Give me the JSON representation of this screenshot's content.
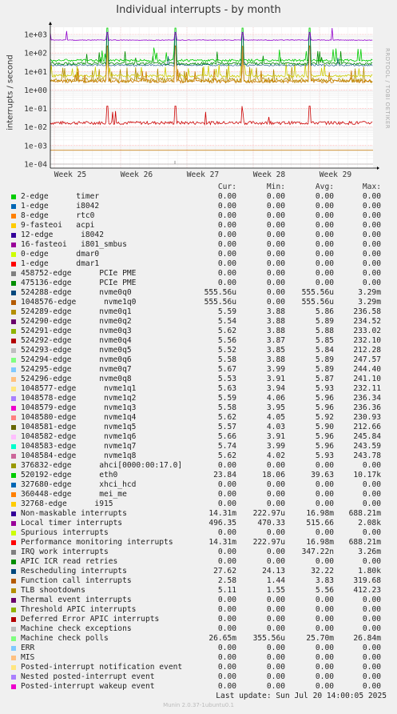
{
  "chart_data": {
    "type": "line",
    "title": "Individual interrupts - by month",
    "ylabel": "interrupts / second",
    "yscale": "log",
    "ylim": [
      0.0001,
      1000
    ],
    "yticks": [
      "1e+03",
      "1e+02",
      "1e+01",
      "1e+00",
      "1e-01",
      "1e-02",
      "1e-03",
      "1e-04"
    ],
    "xticks": [
      "Week 25",
      "Week 26",
      "Week 27",
      "Week 28",
      "Week 29"
    ],
    "grid": true,
    "series_approx": [
      {
        "name": "Local timer interrupts",
        "color": "#8f00cc",
        "level": 496
      },
      {
        "name": "Rescheduling interrupts",
        "color": "#008f00",
        "level": 27
      },
      {
        "name": "Function call interrupts",
        "color": "#cc7a00",
        "level": 3.8
      },
      {
        "name": "Machine check polls",
        "color": "#8f8f00",
        "level": 26
      },
      {
        "name": "TLB shootdowns",
        "color": "#b38f00",
        "level": 5
      },
      {
        "name": "nvme queues",
        "color": "#cccc00",
        "level": 5.8
      },
      {
        "name": "eth0",
        "color": "#00cc00",
        "level": 40
      },
      {
        "name": "Performance monitoring interrupts",
        "color": "#cc0000",
        "level": 0.017
      },
      {
        "name": "nvme0q0",
        "color": "#cc7a00",
        "level": 0.000556
      },
      {
        "name": "IRQ work interrupts",
        "color": "#b0b0b0",
        "level": 0.0001
      }
    ]
  },
  "watermark": "RRDTOOL / TOBI OETIKER",
  "legend_header": {
    "cur": "Cur:",
    "min": "Min:",
    "avg": "Avg:",
    "max": "Max:"
  },
  "legend": [
    {
      "label": "2-edge      timer",
      "color": "#00cc00",
      "cur": "0.00",
      "min": "0.00",
      "avg": "0.00",
      "max": "0.00"
    },
    {
      "label": "1-edge      i8042",
      "color": "#0066b3",
      "cur": "0.00",
      "min": "0.00",
      "avg": "0.00",
      "max": "0.00"
    },
    {
      "label": "8-edge      rtc0",
      "color": "#ff8000",
      "cur": "0.00",
      "min": "0.00",
      "avg": "0.00",
      "max": "0.00"
    },
    {
      "label": "9-fasteoi   acpi",
      "color": "#ffcc00",
      "cur": "0.00",
      "min": "0.00",
      "avg": "0.00",
      "max": "0.00"
    },
    {
      "label": "12-edge      i8042",
      "color": "#330099",
      "cur": "0.00",
      "min": "0.00",
      "avg": "0.00",
      "max": "0.00"
    },
    {
      "label": "16-fasteoi   i801_smbus",
      "color": "#990099",
      "cur": "0.00",
      "min": "0.00",
      "avg": "0.00",
      "max": "0.00"
    },
    {
      "label": "0-edge      dmar0",
      "color": "#ccff00",
      "cur": "0.00",
      "min": "0.00",
      "avg": "0.00",
      "max": "0.00"
    },
    {
      "label": "1-edge      dmar1",
      "color": "#ff0000",
      "cur": "0.00",
      "min": "0.00",
      "avg": "0.00",
      "max": "0.00"
    },
    {
      "label": "458752-edge      PCIe PME",
      "color": "#808080",
      "cur": "0.00",
      "min": "0.00",
      "avg": "0.00",
      "max": "0.00"
    },
    {
      "label": "475136-edge      PCIe PME",
      "color": "#008f00",
      "cur": "0.00",
      "min": "0.00",
      "avg": "0.00",
      "max": "0.00"
    },
    {
      "label": "524288-edge      nvme0q0",
      "color": "#00487d",
      "cur": "555.56u",
      "min": "0.00",
      "avg": "555.56u",
      "max": "3.29m"
    },
    {
      "label": "1048576-edge      nvme1q0",
      "color": "#b35a00",
      "cur": "555.56u",
      "min": "0.00",
      "avg": "555.56u",
      "max": "3.29m"
    },
    {
      "label": "524289-edge      nvme0q1",
      "color": "#b38f00",
      "cur": "5.59",
      "min": "3.88",
      "avg": "5.86",
      "max": "236.58"
    },
    {
      "label": "524290-edge      nvme0q2",
      "color": "#6b006b",
      "cur": "5.54",
      "min": "3.88",
      "avg": "5.89",
      "max": "234.52"
    },
    {
      "label": "524291-edge      nvme0q3",
      "color": "#8fb300",
      "cur": "5.62",
      "min": "3.88",
      "avg": "5.88",
      "max": "233.02"
    },
    {
      "label": "524292-edge      nvme0q4",
      "color": "#b30000",
      "cur": "5.56",
      "min": "3.87",
      "avg": "5.85",
      "max": "232.10"
    },
    {
      "label": "524293-edge      nvme0q5",
      "color": "#bebebe",
      "cur": "5.52",
      "min": "3.85",
      "avg": "5.84",
      "max": "212.28"
    },
    {
      "label": "524294-edge      nvme0q6",
      "color": "#80ff80",
      "cur": "5.58",
      "min": "3.88",
      "avg": "5.89",
      "max": "247.57"
    },
    {
      "label": "524295-edge      nvme0q7",
      "color": "#80c9ff",
      "cur": "5.67",
      "min": "3.99",
      "avg": "5.89",
      "max": "244.40"
    },
    {
      "label": "524296-edge      nvme0q8",
      "color": "#ffc080",
      "cur": "5.53",
      "min": "3.91",
      "avg": "5.87",
      "max": "241.10"
    },
    {
      "label": "1048577-edge      nvme1q1",
      "color": "#ffe680",
      "cur": "5.63",
      "min": "3.94",
      "avg": "5.93",
      "max": "232.11"
    },
    {
      "label": "1048578-edge      nvme1q2",
      "color": "#aa80ff",
      "cur": "5.59",
      "min": "4.06",
      "avg": "5.96",
      "max": "236.34"
    },
    {
      "label": "1048579-edge      nvme1q3",
      "color": "#ee00cc",
      "cur": "5.58",
      "min": "3.95",
      "avg": "5.96",
      "max": "236.36"
    },
    {
      "label": "1048580-edge      nvme1q4",
      "color": "#ff8080",
      "cur": "5.62",
      "min": "4.05",
      "avg": "5.92",
      "max": "230.93"
    },
    {
      "label": "1048581-edge      nvme1q5",
      "color": "#666600",
      "cur": "5.57",
      "min": "4.03",
      "avg": "5.90",
      "max": "212.66"
    },
    {
      "label": "1048582-edge      nvme1q6",
      "color": "#ffbfff",
      "cur": "5.66",
      "min": "3.91",
      "avg": "5.96",
      "max": "245.84"
    },
    {
      "label": "1048583-edge      nvme1q7",
      "color": "#00ffcc",
      "cur": "5.74",
      "min": "3.99",
      "avg": "5.96",
      "max": "243.59"
    },
    {
      "label": "1048584-edge      nvme1q8",
      "color": "#cc6699",
      "cur": "5.62",
      "min": "4.02",
      "avg": "5.93",
      "max": "243.78"
    },
    {
      "label": "376832-edge      ahci[0000:00:17.0]",
      "color": "#999900",
      "cur": "0.00",
      "min": "0.00",
      "avg": "0.00",
      "max": "0.00"
    },
    {
      "label": "520192-edge      eth0",
      "color": "#00cc00",
      "cur": "23.84",
      "min": "18.06",
      "avg": "39.63",
      "max": "10.17k"
    },
    {
      "label": "327680-edge      xhci_hcd",
      "color": "#0066b3",
      "cur": "0.00",
      "min": "0.00",
      "avg": "0.00",
      "max": "0.00"
    },
    {
      "label": "360448-edge      mei_me",
      "color": "#ff8000",
      "cur": "0.00",
      "min": "0.00",
      "avg": "0.00",
      "max": "0.00"
    },
    {
      "label": "32768-edge      i915",
      "color": "#ffcc00",
      "cur": "0.00",
      "min": "0.00",
      "avg": "0.00",
      "max": "0.00"
    },
    {
      "label": "Non-maskable interrupts",
      "color": "#330099",
      "cur": "14.31m",
      "min": "222.97u",
      "avg": "16.98m",
      "max": "688.21m"
    },
    {
      "label": "Local timer interrupts",
      "color": "#990099",
      "cur": "496.35",
      "min": "470.33",
      "avg": "515.66",
      "max": "2.08k"
    },
    {
      "label": "Spurious interrupts",
      "color": "#ccff00",
      "cur": "0.00",
      "min": "0.00",
      "avg": "0.00",
      "max": "0.00"
    },
    {
      "label": "Performance monitoring interrupts",
      "color": "#ff0000",
      "cur": "14.31m",
      "min": "222.97u",
      "avg": "16.98m",
      "max": "688.21m"
    },
    {
      "label": "IRQ work interrupts",
      "color": "#808080",
      "cur": "0.00",
      "min": "0.00",
      "avg": "347.22n",
      "max": "3.26m"
    },
    {
      "label": "APIC ICR read retries",
      "color": "#008f00",
      "cur": "0.00",
      "min": "0.00",
      "avg": "0.00",
      "max": "0.00"
    },
    {
      "label": "Rescheduling interrupts",
      "color": "#00487d",
      "cur": "27.62",
      "min": "24.13",
      "avg": "32.22",
      "max": "1.80k"
    },
    {
      "label": "Function call interrupts",
      "color": "#b35a00",
      "cur": "2.58",
      "min": "1.44",
      "avg": "3.83",
      "max": "319.68"
    },
    {
      "label": "TLB shootdowns",
      "color": "#b38f00",
      "cur": "5.11",
      "min": "1.55",
      "avg": "5.56",
      "max": "412.23"
    },
    {
      "label": "Thermal event interrupts",
      "color": "#6b006b",
      "cur": "0.00",
      "min": "0.00",
      "avg": "0.00",
      "max": "0.00"
    },
    {
      "label": "Threshold APIC interrupts",
      "color": "#8fb300",
      "cur": "0.00",
      "min": "0.00",
      "avg": "0.00",
      "max": "0.00"
    },
    {
      "label": "Deferred Error APIC interrupts",
      "color": "#b30000",
      "cur": "0.00",
      "min": "0.00",
      "avg": "0.00",
      "max": "0.00"
    },
    {
      "label": "Machine check exceptions",
      "color": "#bebebe",
      "cur": "0.00",
      "min": "0.00",
      "avg": "0.00",
      "max": "0.00"
    },
    {
      "label": "Machine check polls",
      "color": "#80ff80",
      "cur": "26.65m",
      "min": "355.56u",
      "avg": "25.70m",
      "max": "26.84m"
    },
    {
      "label": "ERR",
      "color": "#80c9ff",
      "cur": "0.00",
      "min": "0.00",
      "avg": "0.00",
      "max": "0.00"
    },
    {
      "label": "MIS",
      "color": "#ffc080",
      "cur": "0.00",
      "min": "0.00",
      "avg": "0.00",
      "max": "0.00"
    },
    {
      "label": "Posted-interrupt notification event",
      "color": "#ffe680",
      "cur": "0.00",
      "min": "0.00",
      "avg": "0.00",
      "max": "0.00"
    },
    {
      "label": "Nested posted-interrupt event",
      "color": "#aa80ff",
      "cur": "0.00",
      "min": "0.00",
      "avg": "0.00",
      "max": "0.00"
    },
    {
      "label": "Posted-interrupt wakeup event",
      "color": "#ee00cc",
      "cur": "0.00",
      "min": "0.00",
      "avg": "0.00",
      "max": "0.00"
    }
  ],
  "last_update": "Last update: Sun Jul 20 14:00:05 2025",
  "munin_version": "Munin 2.0.37-1ubuntu0.1"
}
